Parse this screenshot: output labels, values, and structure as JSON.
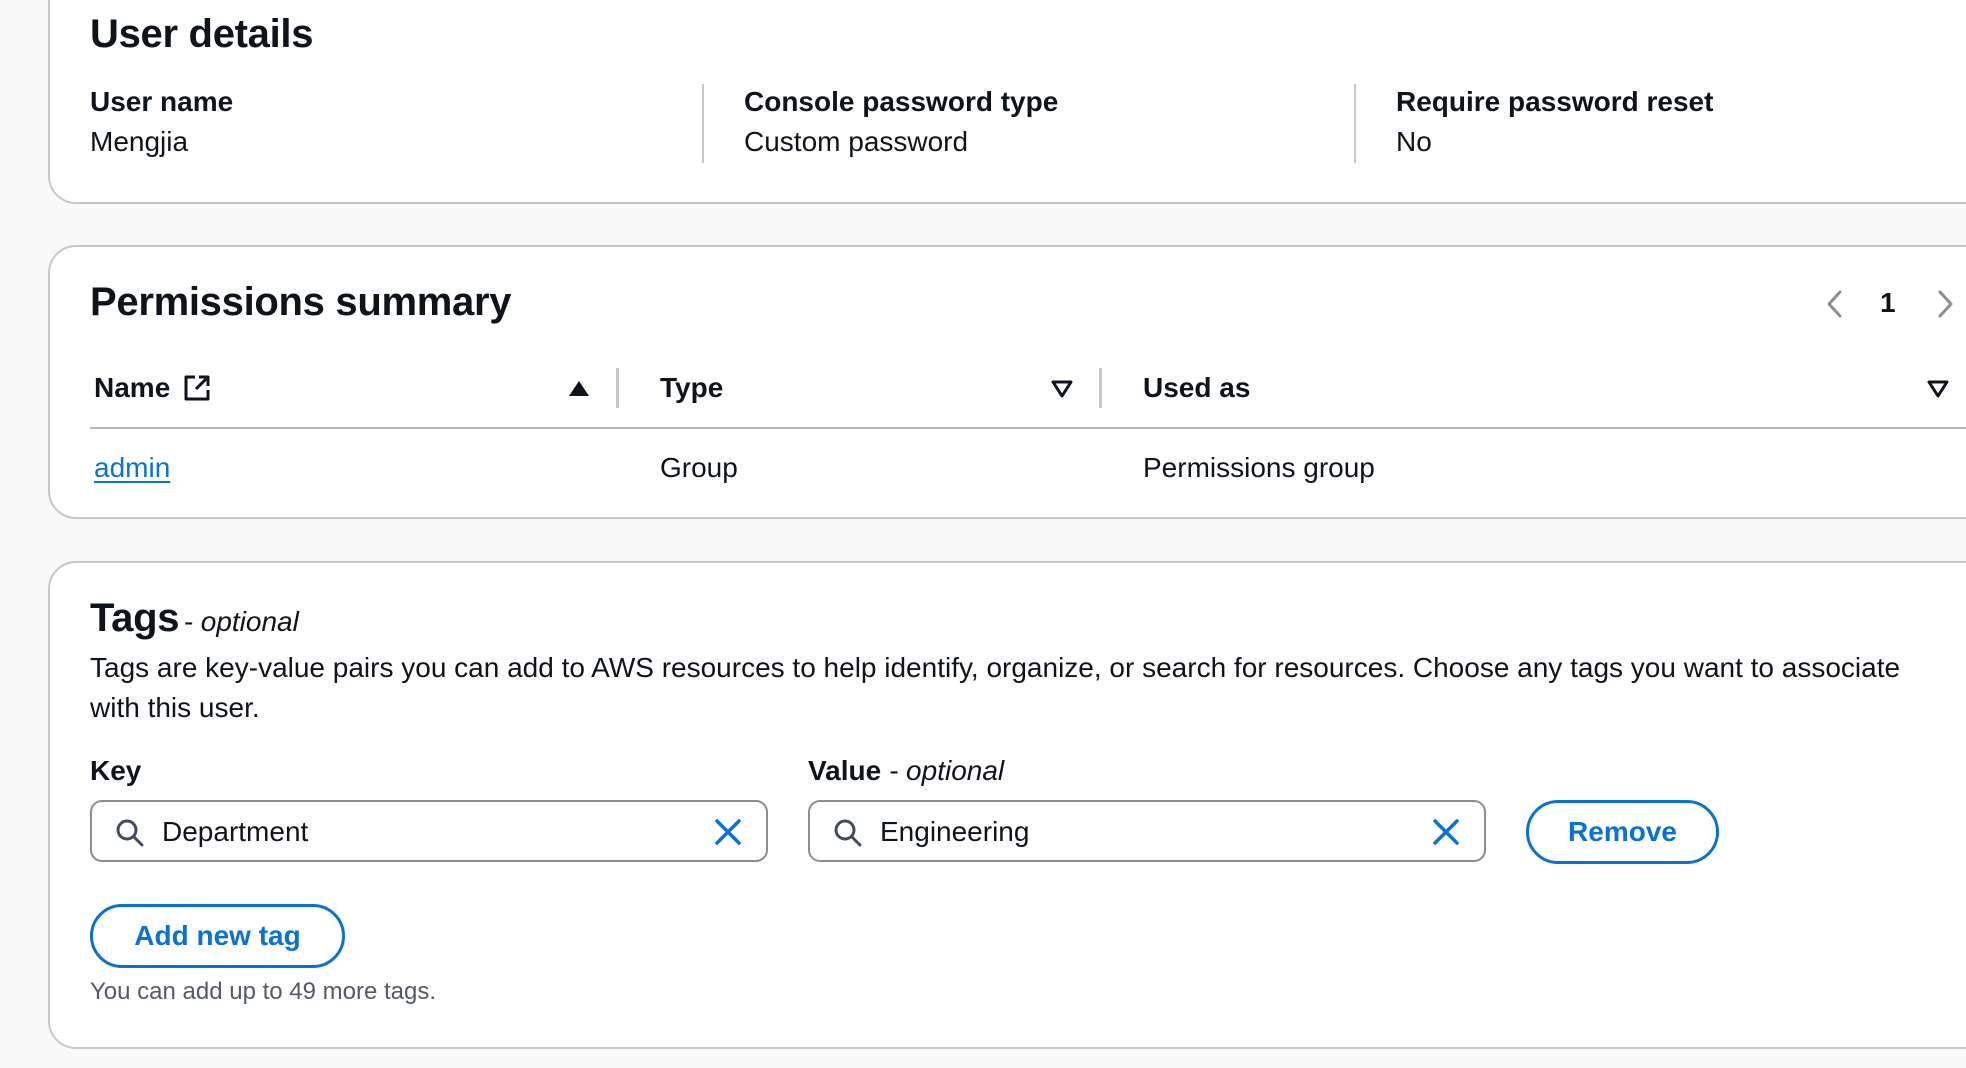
{
  "user_details": {
    "title": "User details",
    "fields": [
      {
        "label": "User name",
        "value": "Mengjia"
      },
      {
        "label": "Console password type",
        "value": "Custom password"
      },
      {
        "label": "Require password reset",
        "value": "No"
      }
    ]
  },
  "permissions_summary": {
    "title": "Permissions summary",
    "pagination": {
      "current_page": "1"
    },
    "columns": [
      {
        "label": "Name",
        "sort": "ascending"
      },
      {
        "label": "Type",
        "sort": "none"
      },
      {
        "label": "Used as",
        "sort": "none"
      }
    ],
    "rows": [
      {
        "name": "admin",
        "type": "Group",
        "used_as": "Permissions group"
      }
    ]
  },
  "tags": {
    "title": "Tags",
    "title_suffix": "- optional",
    "description": "Tags are key-value pairs you can add to AWS resources to help identify, organize, or search for resources. Choose any tags you want to associate with this user.",
    "key_label": "Key",
    "value_label": "Value",
    "value_label_suffix": "- optional",
    "entries": [
      {
        "key": "Department",
        "value": "Engineering"
      }
    ],
    "remove_label": "Remove",
    "add_label": "Add new tag",
    "hint": "You can add up to 49 more tags."
  },
  "colors": {
    "accent": "#0972d3",
    "text": "#0f141a",
    "border": "#c6c6cd",
    "background": "#f9f9fa"
  }
}
